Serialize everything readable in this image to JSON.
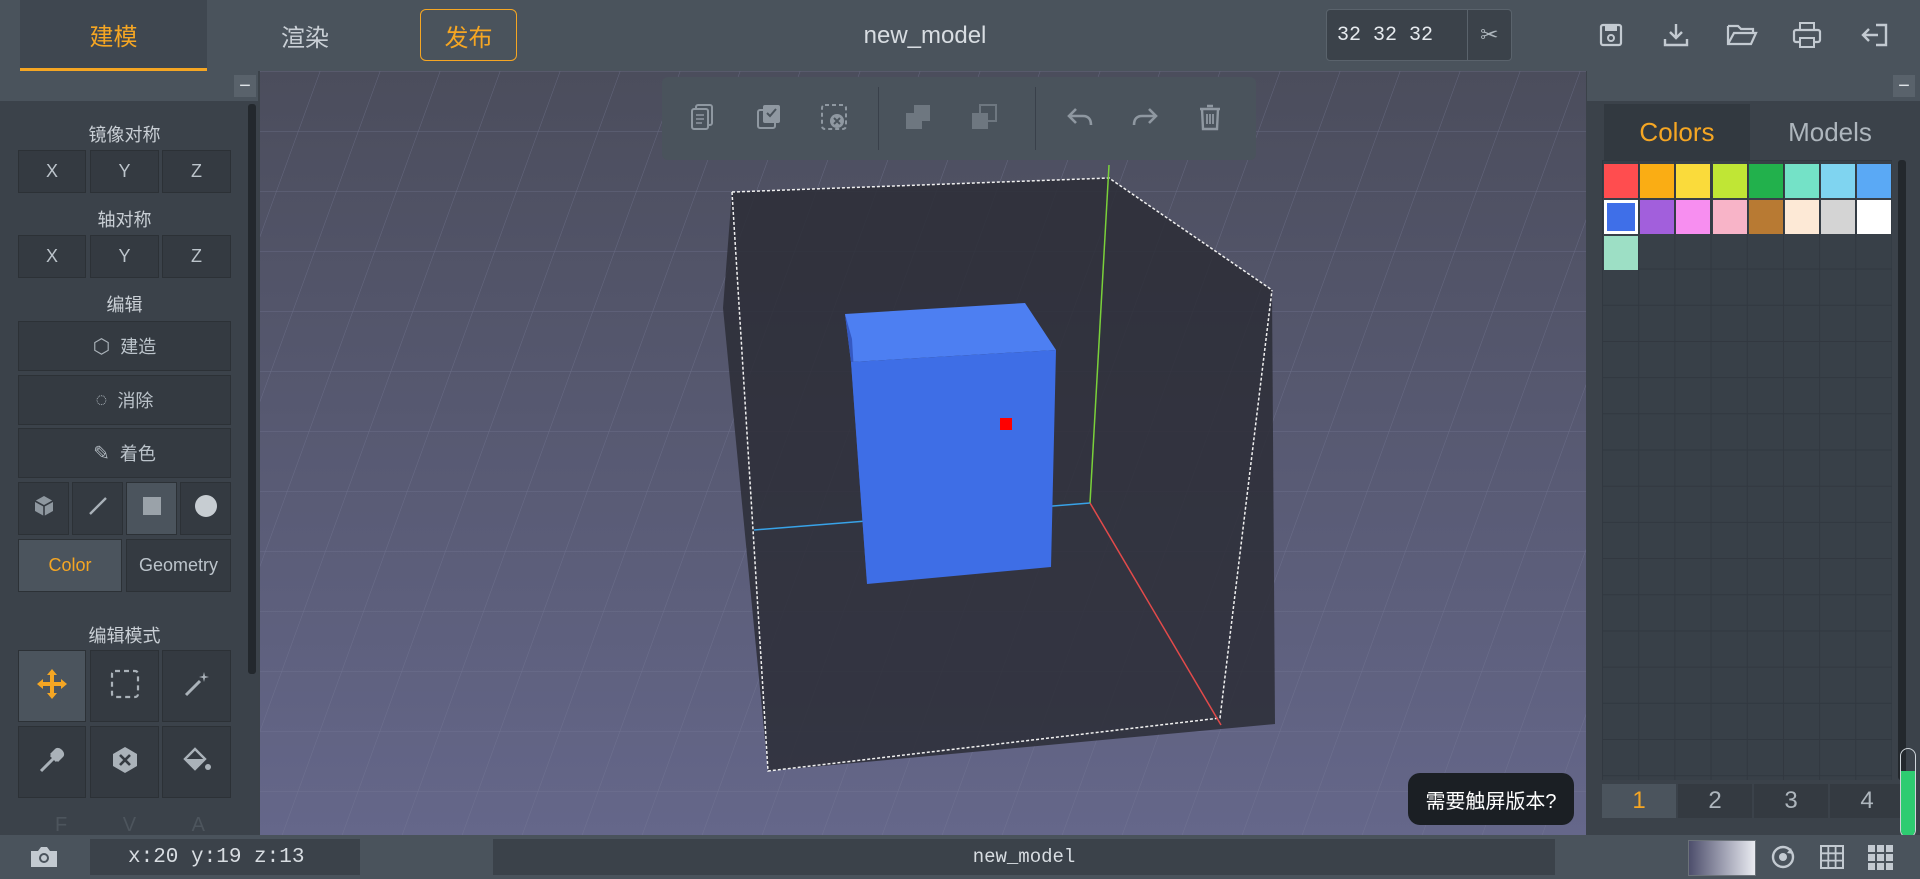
{
  "header": {
    "tabs": [
      {
        "label": "建模",
        "active": true
      },
      {
        "label": "渲染",
        "active": false
      },
      {
        "label": "发布",
        "active": false
      }
    ],
    "title": "new_model",
    "size_value": "32 32 32",
    "icons": [
      "scissors-icon",
      "save-icon",
      "download-icon",
      "folder-open-icon",
      "print-icon",
      "exit-icon"
    ],
    "accent_color": "#f5a623"
  },
  "left_panel": {
    "mirror_title": "镜像对称",
    "mirror_axes": [
      "X",
      "Y",
      "Z"
    ],
    "axis_title": "轴对称",
    "axis_axes": [
      "X",
      "Y",
      "Z"
    ],
    "edit_title": "编辑",
    "edit_actions": [
      {
        "label": "建造",
        "icon": "build-icon"
      },
      {
        "label": "消除",
        "icon": "erase-icon"
      },
      {
        "label": "着色",
        "icon": "paint-brush-icon"
      }
    ],
    "shapes": [
      "cube-icon",
      "line-icon",
      "square-icon",
      "circle-icon"
    ],
    "mode_tabs": [
      {
        "label": "Color",
        "active": true
      },
      {
        "label": "Geometry",
        "active": false
      }
    ],
    "edit_mode_title": "编辑模式",
    "edit_mode_tools": [
      "move-icon",
      "select-box-icon",
      "magic-wand-icon",
      "eyedropper-icon",
      "hexagon-x-icon",
      "paint-bucket-icon"
    ],
    "faded_letters": [
      "F",
      "V",
      "A"
    ]
  },
  "toolbar": {
    "icons": [
      "copy-icon",
      "paste-icon",
      "clear-selection-icon",
      "union-icon",
      "subtract-icon",
      "undo-icon",
      "redo-icon",
      "delete-icon"
    ]
  },
  "right_panel": {
    "tabs": [
      {
        "label": "Colors",
        "active": true
      },
      {
        "label": "Models",
        "active": false
      }
    ],
    "palette": [
      "#ff4d4f",
      "#faad14",
      "#fadb3b",
      "#c0e635",
      "#22b14c",
      "#74e2c7",
      "#7fd4f0",
      "#5aa9f5",
      "#3f6fe8",
      "#a25fdc",
      "#f78ef0",
      "#f8b4c8",
      "#b87a33",
      "#fde9d6",
      "#d4d4d4",
      "#ffffff",
      "#9ddfc5"
    ],
    "selected_color": "#3f6fe8",
    "pages": [
      "1",
      "2",
      "3",
      "4"
    ],
    "active_page": "1",
    "volume_level": 0.75
  },
  "viewport": {
    "touch_prompt": "需要触屏版本?"
  },
  "status_bar": {
    "coords": "x:20 y:19 z:13",
    "filename": "new_model"
  }
}
